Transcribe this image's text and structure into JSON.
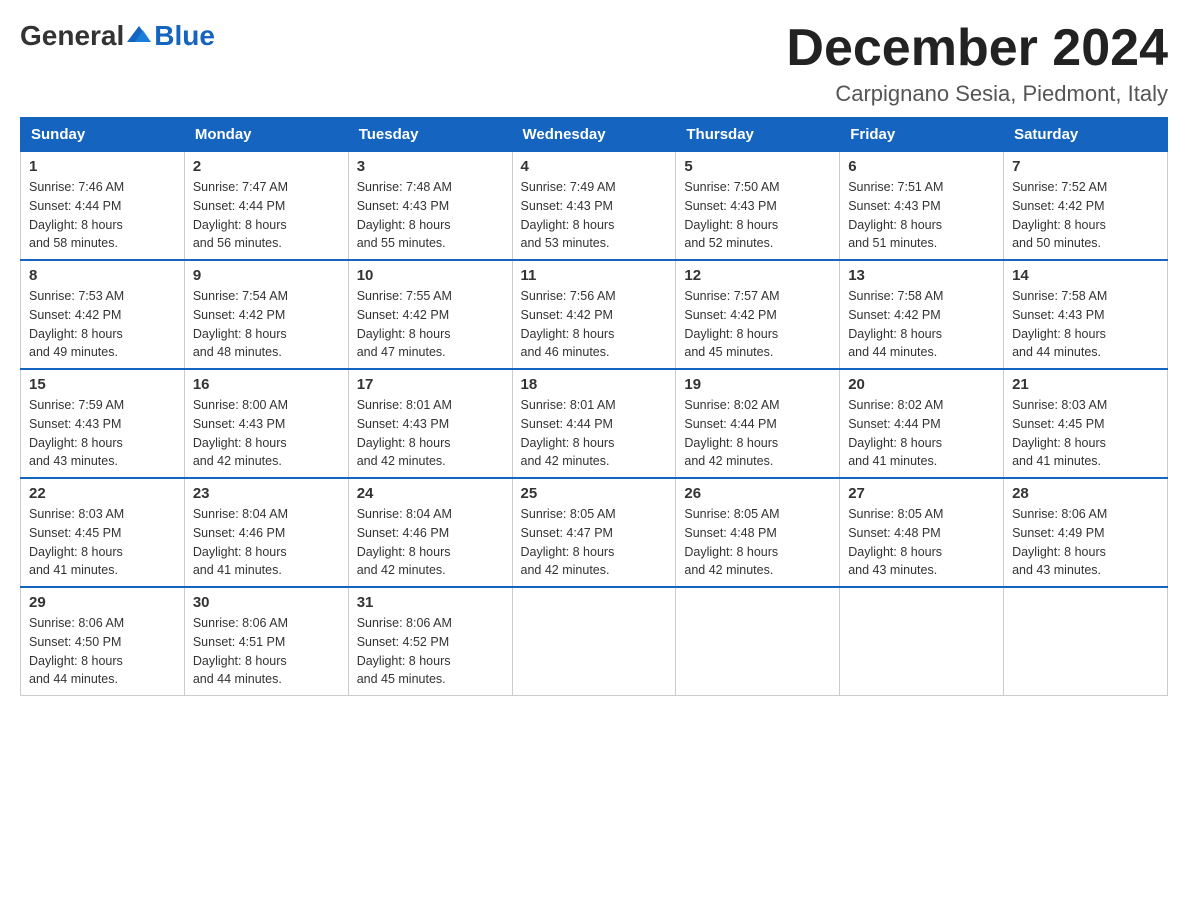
{
  "header": {
    "logo_general": "General",
    "logo_blue": "Blue",
    "month_title": "December 2024",
    "subtitle": "Carpignano Sesia, Piedmont, Italy"
  },
  "days_of_week": [
    "Sunday",
    "Monday",
    "Tuesday",
    "Wednesday",
    "Thursday",
    "Friday",
    "Saturday"
  ],
  "weeks": [
    [
      {
        "day": "1",
        "sunrise": "7:46 AM",
        "sunset": "4:44 PM",
        "daylight_hours": "8",
        "daylight_minutes": "58"
      },
      {
        "day": "2",
        "sunrise": "7:47 AM",
        "sunset": "4:44 PM",
        "daylight_hours": "8",
        "daylight_minutes": "56"
      },
      {
        "day": "3",
        "sunrise": "7:48 AM",
        "sunset": "4:43 PM",
        "daylight_hours": "8",
        "daylight_minutes": "55"
      },
      {
        "day": "4",
        "sunrise": "7:49 AM",
        "sunset": "4:43 PM",
        "daylight_hours": "8",
        "daylight_minutes": "53"
      },
      {
        "day": "5",
        "sunrise": "7:50 AM",
        "sunset": "4:43 PM",
        "daylight_hours": "8",
        "daylight_minutes": "52"
      },
      {
        "day": "6",
        "sunrise": "7:51 AM",
        "sunset": "4:43 PM",
        "daylight_hours": "8",
        "daylight_minutes": "51"
      },
      {
        "day": "7",
        "sunrise": "7:52 AM",
        "sunset": "4:42 PM",
        "daylight_hours": "8",
        "daylight_minutes": "50"
      }
    ],
    [
      {
        "day": "8",
        "sunrise": "7:53 AM",
        "sunset": "4:42 PM",
        "daylight_hours": "8",
        "daylight_minutes": "49"
      },
      {
        "day": "9",
        "sunrise": "7:54 AM",
        "sunset": "4:42 PM",
        "daylight_hours": "8",
        "daylight_minutes": "48"
      },
      {
        "day": "10",
        "sunrise": "7:55 AM",
        "sunset": "4:42 PM",
        "daylight_hours": "8",
        "daylight_minutes": "47"
      },
      {
        "day": "11",
        "sunrise": "7:56 AM",
        "sunset": "4:42 PM",
        "daylight_hours": "8",
        "daylight_minutes": "46"
      },
      {
        "day": "12",
        "sunrise": "7:57 AM",
        "sunset": "4:42 PM",
        "daylight_hours": "8",
        "daylight_minutes": "45"
      },
      {
        "day": "13",
        "sunrise": "7:58 AM",
        "sunset": "4:42 PM",
        "daylight_hours": "8",
        "daylight_minutes": "44"
      },
      {
        "day": "14",
        "sunrise": "7:58 AM",
        "sunset": "4:43 PM",
        "daylight_hours": "8",
        "daylight_minutes": "44"
      }
    ],
    [
      {
        "day": "15",
        "sunrise": "7:59 AM",
        "sunset": "4:43 PM",
        "daylight_hours": "8",
        "daylight_minutes": "43"
      },
      {
        "day": "16",
        "sunrise": "8:00 AM",
        "sunset": "4:43 PM",
        "daylight_hours": "8",
        "daylight_minutes": "42"
      },
      {
        "day": "17",
        "sunrise": "8:01 AM",
        "sunset": "4:43 PM",
        "daylight_hours": "8",
        "daylight_minutes": "42"
      },
      {
        "day": "18",
        "sunrise": "8:01 AM",
        "sunset": "4:44 PM",
        "daylight_hours": "8",
        "daylight_minutes": "42"
      },
      {
        "day": "19",
        "sunrise": "8:02 AM",
        "sunset": "4:44 PM",
        "daylight_hours": "8",
        "daylight_minutes": "42"
      },
      {
        "day": "20",
        "sunrise": "8:02 AM",
        "sunset": "4:44 PM",
        "daylight_hours": "8",
        "daylight_minutes": "41"
      },
      {
        "day": "21",
        "sunrise": "8:03 AM",
        "sunset": "4:45 PM",
        "daylight_hours": "8",
        "daylight_minutes": "41"
      }
    ],
    [
      {
        "day": "22",
        "sunrise": "8:03 AM",
        "sunset": "4:45 PM",
        "daylight_hours": "8",
        "daylight_minutes": "41"
      },
      {
        "day": "23",
        "sunrise": "8:04 AM",
        "sunset": "4:46 PM",
        "daylight_hours": "8",
        "daylight_minutes": "41"
      },
      {
        "day": "24",
        "sunrise": "8:04 AM",
        "sunset": "4:46 PM",
        "daylight_hours": "8",
        "daylight_minutes": "42"
      },
      {
        "day": "25",
        "sunrise": "8:05 AM",
        "sunset": "4:47 PM",
        "daylight_hours": "8",
        "daylight_minutes": "42"
      },
      {
        "day": "26",
        "sunrise": "8:05 AM",
        "sunset": "4:48 PM",
        "daylight_hours": "8",
        "daylight_minutes": "42"
      },
      {
        "day": "27",
        "sunrise": "8:05 AM",
        "sunset": "4:48 PM",
        "daylight_hours": "8",
        "daylight_minutes": "43"
      },
      {
        "day": "28",
        "sunrise": "8:06 AM",
        "sunset": "4:49 PM",
        "daylight_hours": "8",
        "daylight_minutes": "43"
      }
    ],
    [
      {
        "day": "29",
        "sunrise": "8:06 AM",
        "sunset": "4:50 PM",
        "daylight_hours": "8",
        "daylight_minutes": "44"
      },
      {
        "day": "30",
        "sunrise": "8:06 AM",
        "sunset": "4:51 PM",
        "daylight_hours": "8",
        "daylight_minutes": "44"
      },
      {
        "day": "31",
        "sunrise": "8:06 AM",
        "sunset": "4:52 PM",
        "daylight_hours": "8",
        "daylight_minutes": "45"
      },
      null,
      null,
      null,
      null
    ]
  ],
  "labels": {
    "sunrise": "Sunrise:",
    "sunset": "Sunset:",
    "daylight": "Daylight:",
    "hours": "hours",
    "and": "and",
    "minutes": "minutes."
  }
}
